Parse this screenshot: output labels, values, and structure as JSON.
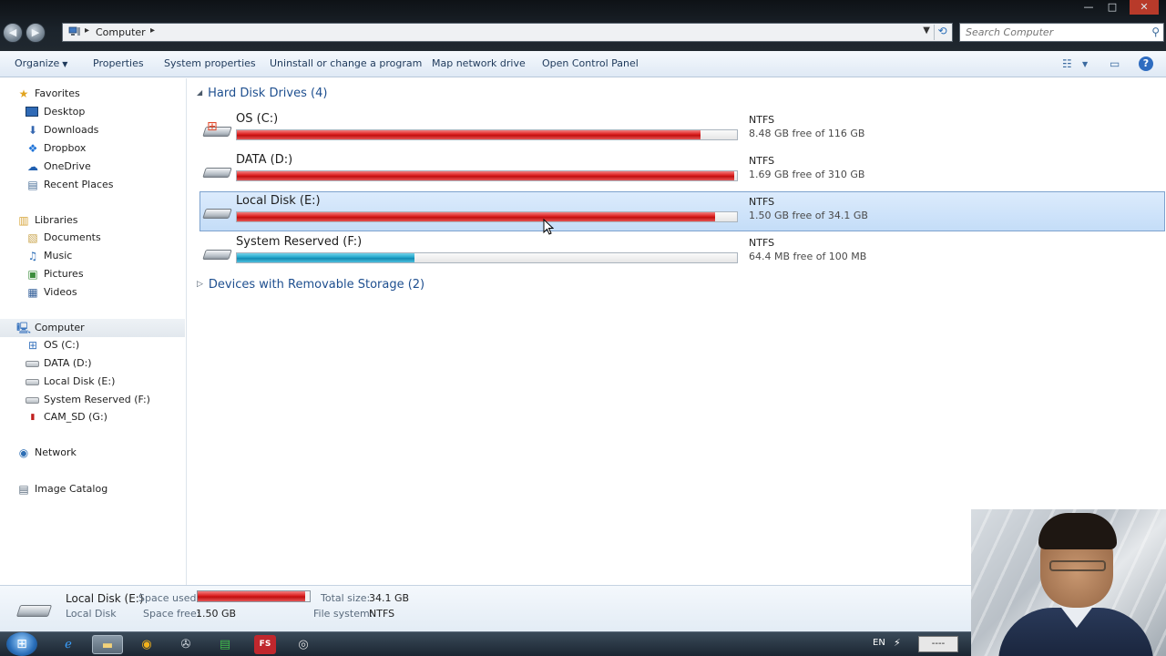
{
  "window": {
    "address": {
      "crumb": "Computer"
    },
    "search": {
      "placeholder": "Search Computer"
    },
    "controls": {
      "minimize": "—",
      "maximize": "□",
      "close": "✕"
    }
  },
  "toolbar": {
    "organize": "Organize",
    "properties": "Properties",
    "system_properties": "System properties",
    "uninstall": "Uninstall or change a program",
    "map_drive": "Map network drive",
    "control_panel": "Open Control Panel"
  },
  "sidebar": {
    "favorites": "Favorites",
    "fav_items": [
      "Desktop",
      "Downloads",
      "Dropbox",
      "OneDrive",
      "Recent Places"
    ],
    "libraries": "Libraries",
    "lib_items": [
      "Documents",
      "Music",
      "Pictures",
      "Videos"
    ],
    "computer": "Computer",
    "computer_items": [
      "OS (C:)",
      "DATA (D:)",
      "Local Disk (E:)",
      "System Reserved (F:)",
      "CAM_SD (G:)"
    ],
    "network": "Network",
    "image_catalog": "Image Catalog"
  },
  "content": {
    "hard_disk_group": "Hard Disk Drives (4)",
    "removable_group": "Devices with Removable Storage (2)",
    "drives": [
      {
        "name": "OS (C:)",
        "fs": "NTFS",
        "free": "8.48 GB free of 116 GB",
        "used_fraction": 0.927,
        "color": "red"
      },
      {
        "name": "DATA (D:)",
        "fs": "NTFS",
        "free": "1.69 GB free of 310 GB",
        "used_fraction": 0.995,
        "color": "red"
      },
      {
        "name": "Local Disk (E:)",
        "fs": "NTFS",
        "free": "1.50 GB free of 34.1 GB",
        "used_fraction": 0.956,
        "color": "red",
        "selected": true
      },
      {
        "name": "System Reserved (F:)",
        "fs": "NTFS",
        "free": "64.4 MB free of 100 MB",
        "used_fraction": 0.356,
        "color": "blue"
      }
    ]
  },
  "details": {
    "name": "Local Disk (E:)",
    "type": "Local Disk",
    "space_used_label": "Space used:",
    "space_free_label": "Space free:",
    "space_free": "1.50 GB",
    "total_size_label": "Total size:",
    "total_size": "34.1 GB",
    "fs_label": "File system:",
    "fs": "NTFS",
    "used_fraction": 0.956
  },
  "taskbar": {
    "lang": "EN",
    "clock": "----"
  },
  "colors": {
    "used_bar_red": "#dc1f1f",
    "used_bar_blue": "#23a6cb",
    "group_header": "#1e4f8f",
    "selection": "#c4ddf8"
  }
}
